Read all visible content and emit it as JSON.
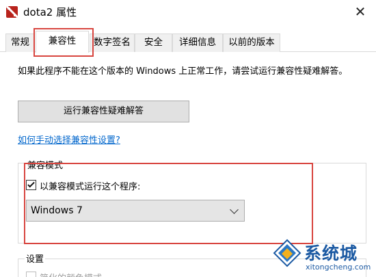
{
  "window": {
    "title": "dota2 属性",
    "close_glyph": "✕",
    "app_icon": "dota2-icon"
  },
  "tabs": [
    {
      "label": "常规",
      "active": false
    },
    {
      "label": "兼容性",
      "active": true
    },
    {
      "label": "数字签名",
      "active": false
    },
    {
      "label": "安全",
      "active": false
    },
    {
      "label": "详细信息",
      "active": false
    },
    {
      "label": "以前的版本",
      "active": false
    }
  ],
  "compat": {
    "description": "如果此程序不能在这个版本的 Windows 上正常工作，请尝试运行兼容性疑难解答。",
    "run_troubleshooter_label": "运行兼容性疑难解答",
    "manual_link": "如何手动选择兼容性设置?",
    "mode_group_title": "兼容模式",
    "mode_checkbox_label": "以兼容模式运行这个程序:",
    "mode_checkbox_checked": true,
    "os_selected": "Windows 7",
    "settings_group_title": "设置",
    "settings_first_option": "简化的颜色模式"
  },
  "highlight_color": "#d8453f",
  "watermark": {
    "main": "系统城",
    "sub": "xitongcheng.com"
  }
}
